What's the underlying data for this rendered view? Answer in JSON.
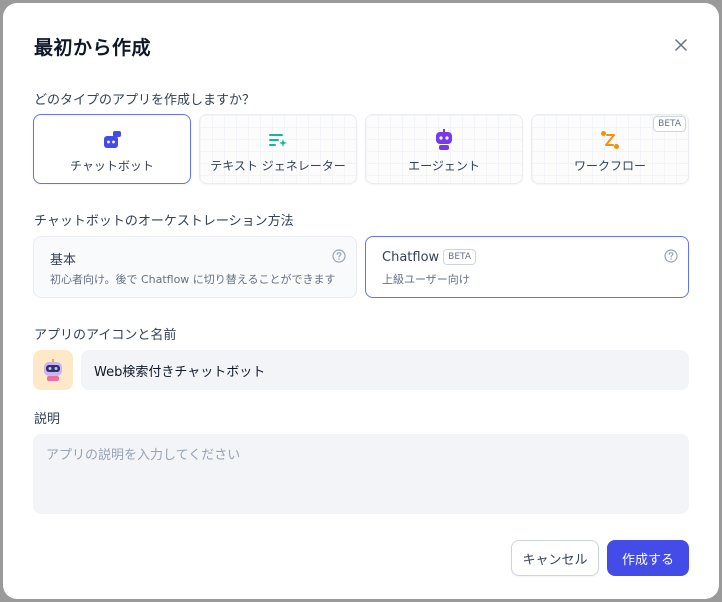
{
  "dialog": {
    "title": "最初から作成"
  },
  "app_type": {
    "question": "どのタイプのアプリを作成しますか？",
    "options": [
      {
        "label": "チャットボット",
        "icon": "chatbot-icon",
        "color": "#444ce7",
        "selected": true
      },
      {
        "label": "テキスト ジェネレーター",
        "icon": "text-generator-icon",
        "color": "#15b79e",
        "selected": false
      },
      {
        "label": "エージェント",
        "icon": "agent-icon",
        "color": "#7839ee",
        "selected": false
      },
      {
        "label": "ワークフロー",
        "icon": "workflow-icon",
        "color": "#f79009",
        "selected": false,
        "badge": "BETA"
      }
    ]
  },
  "orchestration": {
    "label": "チャットボットのオーケストレーション方法",
    "options": [
      {
        "name": "基本",
        "desc": "初心者向け。後で Chatflow に切り替えることができます",
        "selected": false
      },
      {
        "name": "Chatflow",
        "badge": "BETA",
        "desc": "上級ユーザー向け",
        "selected": true
      }
    ]
  },
  "icon_name": {
    "label": "アプリのアイコンと名前",
    "avatar_icon": "robot-icon",
    "name_value": "Web検索付きチャットボット"
  },
  "description": {
    "label": "説明",
    "placeholder": "アプリの説明を入力してください"
  },
  "footer": {
    "cancel_label": "キャンセル",
    "create_label": "作成する"
  },
  "colors": {
    "accent": "#444ce7",
    "selected_border": "#6172f3"
  }
}
